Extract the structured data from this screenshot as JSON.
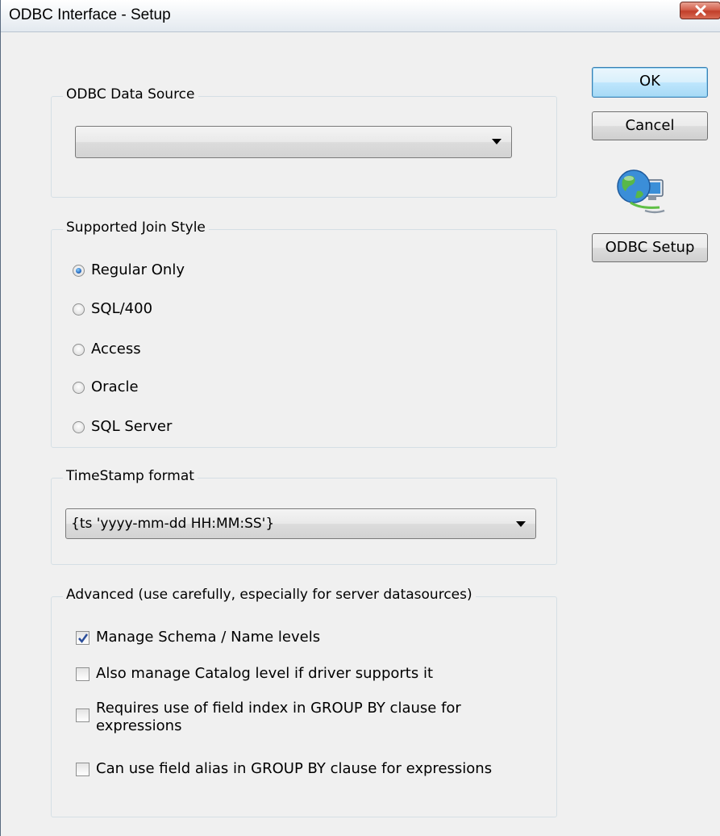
{
  "window": {
    "title": "ODBC Interface - Setup"
  },
  "data_source": {
    "legend": "ODBC Data Source",
    "selected": ""
  },
  "join_style": {
    "legend": "Supported Join Style",
    "options": [
      {
        "label": "Regular Only",
        "checked": true
      },
      {
        "label": "SQL/400",
        "checked": false
      },
      {
        "label": "Access",
        "checked": false
      },
      {
        "label": "Oracle",
        "checked": false
      },
      {
        "label": "SQL Server",
        "checked": false
      }
    ]
  },
  "timestamp": {
    "legend": "TimeStamp format",
    "selected": "{ts 'yyyy-mm-dd HH:MM:SS'}"
  },
  "advanced": {
    "legend": "Advanced (use carefully, especially for server datasources)",
    "options": [
      {
        "label": "Manage Schema / Name levels",
        "checked": true
      },
      {
        "label": "Also manage Catalog level if driver supports it",
        "checked": false
      },
      {
        "label_line1": "Requires use of field index in GROUP BY clause for",
        "label_line2": "expressions",
        "checked": false
      },
      {
        "label": "Can use  field alias in GROUP BY clause for expressions",
        "checked": false
      }
    ]
  },
  "buttons": {
    "ok": "OK",
    "cancel": "Cancel",
    "odbc_setup": "ODBC Setup"
  },
  "icons": {
    "close": "close-icon",
    "network": "network-globe-icon"
  },
  "colors": {
    "accent": "#3c7fb1",
    "close": "#c13f2a",
    "check": "#2a4d9a"
  }
}
